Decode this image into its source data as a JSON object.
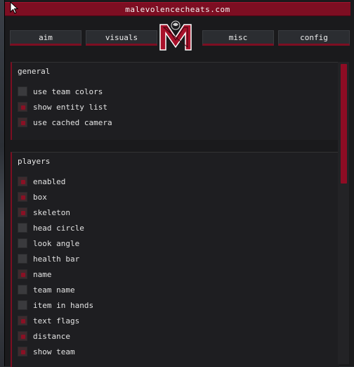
{
  "window": {
    "title": "malevolencecheats.com"
  },
  "tabs": [
    {
      "label": "aim"
    },
    {
      "label": "visuals"
    },
    {
      "label": "misc"
    },
    {
      "label": "config"
    }
  ],
  "colors": {
    "accent": "#7d0e22",
    "bg": "#1a1a1c",
    "panel": "#1e1e21"
  },
  "sections": {
    "general": {
      "title": "general",
      "items": [
        {
          "label": "use team colors",
          "checked": false
        },
        {
          "label": "show entity list",
          "checked": true
        },
        {
          "label": "use cached camera",
          "checked": true
        }
      ]
    },
    "players": {
      "title": "players",
      "items": [
        {
          "label": "enabled",
          "checked": true
        },
        {
          "label": "box",
          "checked": true
        },
        {
          "label": "skeleton",
          "checked": true
        },
        {
          "label": "head circle",
          "checked": false
        },
        {
          "label": "look angle",
          "checked": false
        },
        {
          "label": "health bar",
          "checked": false
        },
        {
          "label": "name",
          "checked": true
        },
        {
          "label": "team name",
          "checked": false
        },
        {
          "label": "item in hands",
          "checked": false
        },
        {
          "label": "text flags",
          "checked": true
        },
        {
          "label": "distance",
          "checked": true
        },
        {
          "label": "show team",
          "checked": true
        }
      ]
    }
  }
}
